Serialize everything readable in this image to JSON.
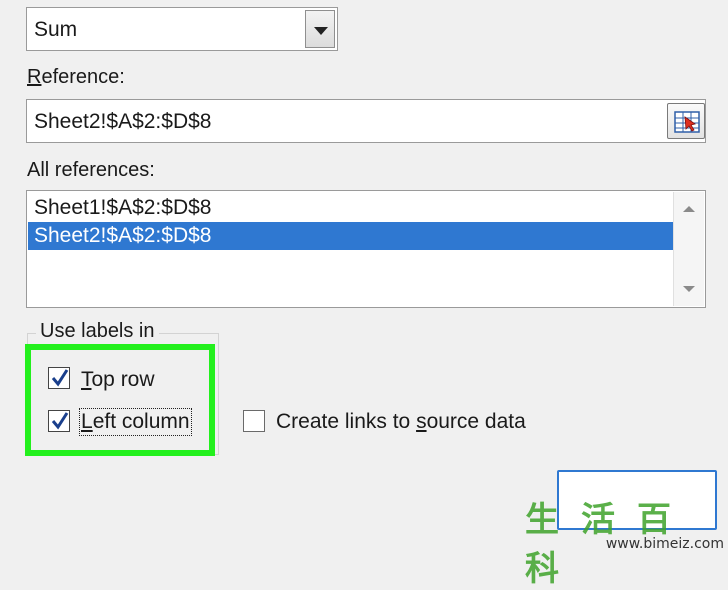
{
  "function": {
    "value": "Sum"
  },
  "reference": {
    "label_prefix": "",
    "label_underlined": "R",
    "label_rest": "eference:",
    "value": "Sheet2!$A$2:$D$8"
  },
  "all_references": {
    "label": "All references:",
    "items": [
      "Sheet1!$A$2:$D$8",
      "Sheet2!$A$2:$D$8"
    ],
    "selected_index": 1
  },
  "use_labels": {
    "title": "Use labels in",
    "top_row": {
      "underlined": "T",
      "rest": "op row",
      "checked": true
    },
    "left_column": {
      "underlined": "L",
      "rest": "eft column",
      "checked": true
    }
  },
  "create_links": {
    "prefix": "Create links to ",
    "underlined": "s",
    "rest": "ource data",
    "checked": false
  },
  "colors": {
    "highlight": "#23f01d",
    "selection": "#2f78d1"
  },
  "watermark": {
    "chars": "生活百科",
    "url": "www.bimeiz.com"
  }
}
